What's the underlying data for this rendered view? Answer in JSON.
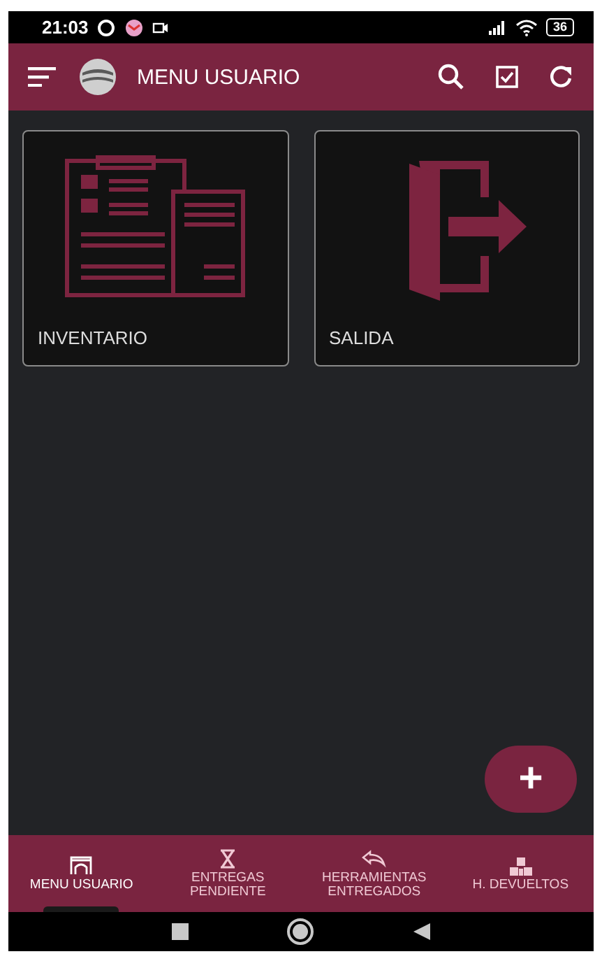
{
  "status_bar": {
    "time": "21:03",
    "battery": "36"
  },
  "app_bar": {
    "title": "MENU USUARIO"
  },
  "tiles": [
    {
      "kind": "inventory",
      "label": "INVENTARIO"
    },
    {
      "kind": "exit",
      "label": "SALIDA"
    }
  ],
  "fab": {
    "label": "+"
  },
  "bottom_nav": [
    {
      "kind": "arch",
      "label": "MENU USUARIO",
      "selected": true
    },
    {
      "kind": "hourglass",
      "label": "ENTREGAS PENDIENTE",
      "selected": false
    },
    {
      "kind": "return",
      "label": "HERRAMIENTAS ENTREGADOS",
      "selected": false
    },
    {
      "kind": "boxes",
      "label": "H. DEVUELTOS",
      "selected": false
    }
  ]
}
